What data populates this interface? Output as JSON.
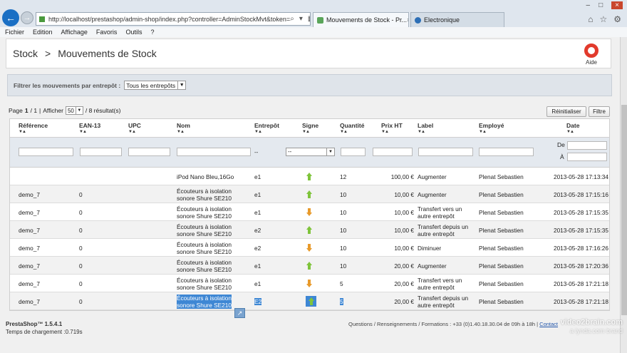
{
  "browser": {
    "url": "http://localhost/prestashop/admin-shop/index.php?controller=AdminStockMvt&token=",
    "tabs": [
      {
        "label": "Mouvements de Stock - Pr..."
      },
      {
        "label": "Electronique"
      }
    ],
    "menu": [
      "Fichier",
      "Edition",
      "Affichage",
      "Favoris",
      "Outils",
      "?"
    ]
  },
  "toolbar": {
    "breadcrumb_root": "Stock",
    "breadcrumb_sep": ">",
    "breadcrumb_current": "Mouvements de Stock",
    "help_label": "Aide"
  },
  "filter": {
    "label": "Filtrer les mouvements par entrepôt :",
    "warehouse_value": "Tous les entrepôts"
  },
  "pager": {
    "text_page": "Page",
    "current": "1",
    "total": "/ 1",
    "sep": "|",
    "show_label": "Afficher",
    "per_page": "50",
    "results": "/ 8 résultat(s)"
  },
  "buttons": {
    "reset": "Réinitialiser",
    "filter": "Filtre"
  },
  "table": {
    "headers": [
      "Référence",
      "EAN-13",
      "UPC",
      "Nom",
      "Entrepôt",
      "Signe",
      "Quantité",
      "Prix HT",
      "Label",
      "Employé",
      "Date"
    ],
    "filter_row": {
      "warehouse_dash": "--",
      "sign_select": "--",
      "date_from": "De",
      "date_to": "À"
    },
    "rows": [
      {
        "ref": "",
        "ean": "",
        "upc": "",
        "name": [
          "iPod Nano Bleu,16Go"
        ],
        "warehouse": "e1",
        "sign": "up",
        "qty": "12",
        "price": "100,00 €",
        "label": [
          "Augmenter"
        ],
        "employee": "Plenat Sebastien",
        "date": "2013-05-28 17:13:34"
      },
      {
        "ref": "demo_7",
        "ean": "0",
        "upc": "",
        "name": [
          "Écouteurs à isolation",
          "sonore Shure SE210"
        ],
        "warehouse": "e1",
        "sign": "up",
        "qty": "10",
        "price": "10,00 €",
        "label": [
          "Augmenter"
        ],
        "employee": "Plenat Sebastien",
        "date": "2013-05-28 17:15:16"
      },
      {
        "ref": "demo_7",
        "ean": "0",
        "upc": "",
        "name": [
          "Écouteurs à isolation",
          "sonore Shure SE210"
        ],
        "warehouse": "e1",
        "sign": "down",
        "qty": "10",
        "price": "10,00 €",
        "label": [
          "Transfert vers un",
          "autre entrepôt"
        ],
        "employee": "Plenat Sebastien",
        "date": "2013-05-28 17:15:35"
      },
      {
        "ref": "demo_7",
        "ean": "0",
        "upc": "",
        "name": [
          "Écouteurs à isolation",
          "sonore Shure SE210"
        ],
        "warehouse": "e2",
        "sign": "up",
        "qty": "10",
        "price": "10,00 €",
        "label": [
          "Transfert depuis un",
          "autre entrepôt"
        ],
        "employee": "Plenat Sebastien",
        "date": "2013-05-28 17:15:35"
      },
      {
        "ref": "demo_7",
        "ean": "0",
        "upc": "",
        "name": [
          "Écouteurs à isolation",
          "sonore Shure SE210"
        ],
        "warehouse": "e2",
        "sign": "down",
        "qty": "10",
        "price": "10,00 €",
        "label": [
          "Diminuer"
        ],
        "employee": "Plenat Sebastien",
        "date": "2013-05-28 17:16:26"
      },
      {
        "ref": "demo_7",
        "ean": "0",
        "upc": "",
        "name": [
          "Écouteurs à isolation",
          "sonore Shure SE210"
        ],
        "warehouse": "e1",
        "sign": "up",
        "qty": "10",
        "price": "20,00 €",
        "label": [
          "Augmenter"
        ],
        "employee": "Plenat Sebastien",
        "date": "2013-05-28 17:20:36"
      },
      {
        "ref": "demo_7",
        "ean": "0",
        "upc": "",
        "name": [
          "Écouteurs à isolation",
          "sonore Shure SE210"
        ],
        "warehouse": "e1",
        "sign": "down",
        "qty": "5",
        "price": "20,00 €",
        "label": [
          "Transfert vers un",
          "autre entrepôt"
        ],
        "employee": "Plenat Sebastien",
        "date": "2013-05-28 17:21:18"
      },
      {
        "ref": "demo_7",
        "ean": "0",
        "upc": "",
        "name": [
          "Écouteurs à isolation",
          "sonore Shure SE210"
        ],
        "warehouse": "E2",
        "sign": "up",
        "qty": "5",
        "price": "20,00 €",
        "label": [
          "Transfert depuis un",
          "autre entrepôt"
        ],
        "employee": "Plenat Sebastien",
        "date": "2013-05-28 17:21:18",
        "selected": true
      }
    ]
  },
  "footer": {
    "version": "PrestaShop™ 1.5.4.1",
    "load_time": "Temps de chargement :0.719s",
    "contact_text": "Questions / Renseignements / Formations : +33 (0)1.40.18.30.04 de 09h à 18h |",
    "contact_link": "Contact",
    "watermark1": "video2brain.com",
    "watermark2": "a lynda.com brand"
  }
}
